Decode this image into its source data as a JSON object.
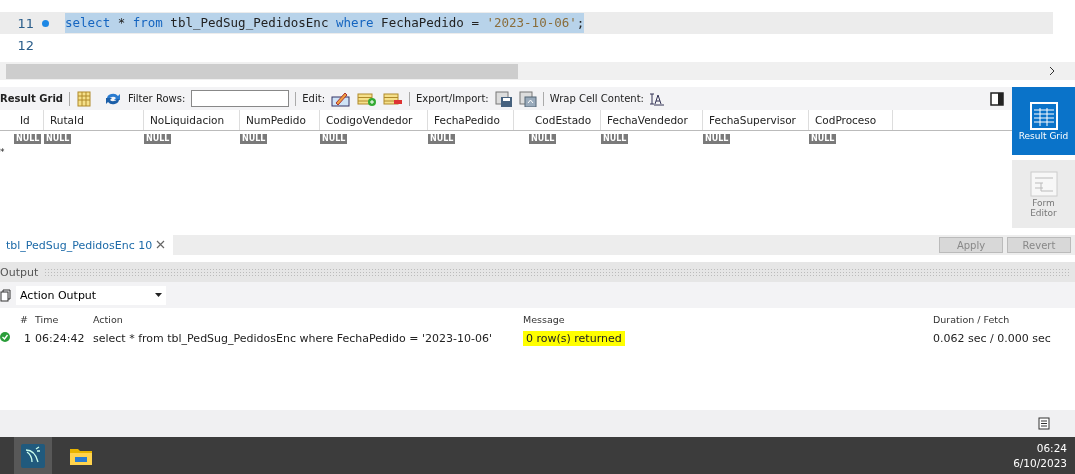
{
  "editor": {
    "lines": [
      {
        "number": "11",
        "breakpoint": true,
        "selected": true,
        "tokens": [
          {
            "kind": "keyword",
            "text": "select"
          },
          {
            "kind": "plain",
            "text": " * "
          },
          {
            "kind": "keyword",
            "text": "from"
          },
          {
            "kind": "plain",
            "text": " tbl_PedSug_PedidosEnc "
          },
          {
            "kind": "keyword",
            "text": "where"
          },
          {
            "kind": "plain",
            "text": " FechaPedido = "
          },
          {
            "kind": "string",
            "text": "'2023-10-06'"
          },
          {
            "kind": "plain",
            "text": ";"
          }
        ]
      },
      {
        "number": "12",
        "breakpoint": false,
        "selected": false
      }
    ]
  },
  "result_toolbar": {
    "title": "Result Grid",
    "filter_label": "Filter Rows:",
    "edit_label": "Edit:",
    "export_label": "Export/Import:",
    "wrap_label": "Wrap Cell Content:"
  },
  "grid": {
    "columns": [
      {
        "name": "Id",
        "null": "NULL"
      },
      {
        "name": "RutaId",
        "null": "NULL"
      },
      {
        "name": "NoLiquidacion",
        "null": "NULL"
      },
      {
        "name": "NumPedido",
        "null": "NULL"
      },
      {
        "name": "CodigoVendedor",
        "null": "NULL"
      },
      {
        "name": "FechaPedido",
        "null": "NULL"
      },
      {
        "name": "CodEstado",
        "null": "NULL"
      },
      {
        "name": "FechaVendedor",
        "null": "NULL"
      },
      {
        "name": "FechaSupervisor",
        "null": "NULL"
      },
      {
        "name": "CodProceso",
        "null": "NULL"
      }
    ],
    "new_row_marker": "*"
  },
  "side_panel": [
    {
      "label": "Result Grid",
      "selected": true
    },
    {
      "label": "Form Editor",
      "selected": false
    }
  ],
  "result_tabs": [
    {
      "label": "tbl_PedSug_PedidosEnc 10",
      "selected": true
    }
  ],
  "result_buttons": [
    {
      "label": "Apply",
      "disabled": true
    },
    {
      "label": "Revert",
      "disabled": true
    }
  ],
  "output": {
    "title": "Output",
    "mode": "Action Output",
    "columns": [
      "#",
      "Time",
      "Action",
      "Message",
      "Duration / Fetch"
    ],
    "rows": [
      {
        "number": "1",
        "time": "06:24:42",
        "action": "select * from tbl_PedSug_PedidosEnc where FechaPedido = '2023-10-06'",
        "message": "0 row(s) returned",
        "highlighted": true,
        "duration": "0.062 sec / 0.000 sec"
      }
    ]
  },
  "taskbar": {
    "time": "06:24",
    "date": "6/10/2023"
  }
}
